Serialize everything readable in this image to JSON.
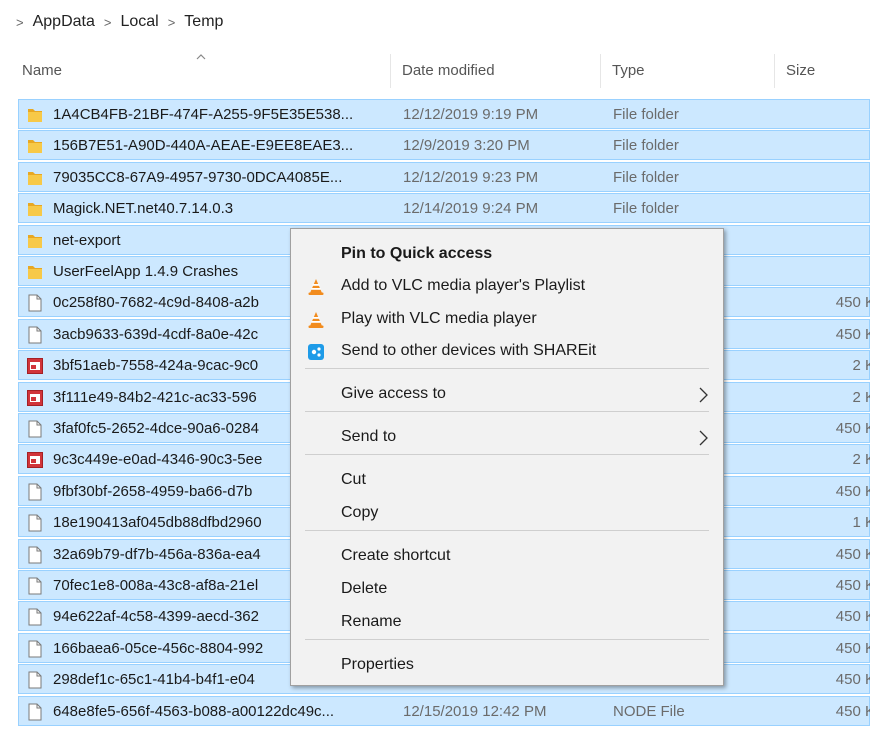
{
  "breadcrumb": {
    "lead": ">",
    "items": [
      "AppData",
      "Local",
      "Temp"
    ],
    "separator": ">"
  },
  "columns": {
    "name": "Name",
    "date": "Date modified",
    "type": "Type",
    "size": "Size"
  },
  "files": [
    {
      "name": "1A4CB4FB-21BF-474F-A255-9F5E35E538...",
      "date": "12/12/2019 9:19 PM",
      "type": "File folder",
      "size": "",
      "icon": "folder-icon",
      "selected": true
    },
    {
      "name": "156B7E51-A90D-440A-AEAE-E9EE8EAE3...",
      "date": "12/9/2019 3:20 PM",
      "type": "File folder",
      "size": "",
      "icon": "folder-icon",
      "selected": true
    },
    {
      "name": "79035CC8-67A9-4957-9730-0DCA4085E...",
      "date": "12/12/2019 9:23 PM",
      "type": "File folder",
      "size": "",
      "icon": "folder-icon",
      "selected": true
    },
    {
      "name": "Magick.NET.net40.7.14.0.3",
      "date": "12/14/2019 9:24 PM",
      "type": "File folder",
      "size": "",
      "icon": "folder-icon",
      "selected": true
    },
    {
      "name": "net-export",
      "date": "",
      "type": "",
      "size": "",
      "icon": "folder-icon",
      "selected": true
    },
    {
      "name": "UserFeelApp 1.4.9 Crashes",
      "date": "",
      "type": "",
      "size": "",
      "icon": "folder-icon",
      "selected": true
    },
    {
      "name": "0c258f80-7682-4c9d-8408-a2b",
      "date": "",
      "type": "",
      "size": "450 K",
      "icon": "file-icon",
      "selected": true
    },
    {
      "name": "3acb9633-639d-4cdf-8a0e-42c",
      "date": "",
      "type": "",
      "size": "450 K",
      "icon": "file-icon",
      "selected": true
    },
    {
      "name": "3bf51aeb-7558-424a-9cac-9c0",
      "date": "",
      "type": "",
      "size": "2 K",
      "icon": "image-file-icon",
      "selected": true
    },
    {
      "name": "3f111e49-84b2-421c-ac33-596",
      "date": "",
      "type": "",
      "size": "2 K",
      "icon": "image-file-icon",
      "selected": true
    },
    {
      "name": "3faf0fc5-2652-4dce-90a6-0284",
      "date": "",
      "type": "",
      "size": "450 K",
      "icon": "file-icon",
      "selected": true
    },
    {
      "name": "9c3c449e-e0ad-4346-90c3-5ee",
      "date": "",
      "type": "",
      "size": "2 K",
      "icon": "image-file-icon",
      "selected": true
    },
    {
      "name": "9fbf30bf-2658-4959-ba66-d7b",
      "date": "",
      "type": "",
      "size": "450 K",
      "icon": "file-icon",
      "selected": true
    },
    {
      "name": "18e190413af045db88dfbd2960",
      "date": "",
      "type": "",
      "size": "1 K",
      "icon": "file-icon",
      "selected": true
    },
    {
      "name": "32a69b79-df7b-456a-836a-ea4",
      "date": "",
      "type": "",
      "size": "450 K",
      "icon": "file-icon",
      "selected": true
    },
    {
      "name": "70fec1e8-008a-43c8-af8a-21el",
      "date": "",
      "type": "",
      "size": "450 K",
      "icon": "file-icon",
      "selected": true
    },
    {
      "name": "94e622af-4c58-4399-aecd-362",
      "date": "",
      "type": "",
      "size": "450 K",
      "icon": "file-icon",
      "selected": true
    },
    {
      "name": "166baea6-05ce-456c-8804-992",
      "date": "",
      "type": "",
      "size": "450 K",
      "icon": "file-icon",
      "selected": true
    },
    {
      "name": "298def1c-65c1-41b4-b4f1-e04",
      "date": "",
      "type": "",
      "size": "450 K",
      "icon": "file-icon",
      "selected": true
    },
    {
      "name": "648e8fe5-656f-4563-b088-a00122dc49c...",
      "date": "12/15/2019 12:42 PM",
      "type": "NODE File",
      "size": "450 K",
      "icon": "file-icon",
      "selected": true
    }
  ],
  "context_menu": {
    "items": [
      {
        "label": "Pin to Quick access",
        "bold": true,
        "icon": "",
        "submenu": false
      },
      {
        "label": "Add to VLC media player's Playlist",
        "bold": false,
        "icon": "vlc-icon",
        "submenu": false
      },
      {
        "label": "Play with VLC media player",
        "bold": false,
        "icon": "vlc-icon",
        "submenu": false
      },
      {
        "label": "Send to other devices with SHAREit",
        "bold": false,
        "icon": "shareit-icon",
        "submenu": false
      },
      {
        "label": "Give access to",
        "bold": false,
        "icon": "",
        "submenu": true
      },
      {
        "label": "Send to",
        "bold": false,
        "icon": "",
        "submenu": true
      },
      {
        "label": "Cut",
        "bold": false,
        "icon": "",
        "submenu": false
      },
      {
        "label": "Copy",
        "bold": false,
        "icon": "",
        "submenu": false
      },
      {
        "label": "Create shortcut",
        "bold": false,
        "icon": "",
        "submenu": false
      },
      {
        "label": "Delete",
        "bold": false,
        "icon": "",
        "submenu": false
      },
      {
        "label": "Rename",
        "bold": false,
        "icon": "",
        "submenu": false
      },
      {
        "label": "Properties",
        "bold": false,
        "icon": "",
        "submenu": false
      }
    ]
  },
  "colors": {
    "selection_bg": "#cce8ff",
    "selection_border": "#99d1ff",
    "folder": "#f4c542",
    "menu_bg": "#f2f2f2"
  }
}
